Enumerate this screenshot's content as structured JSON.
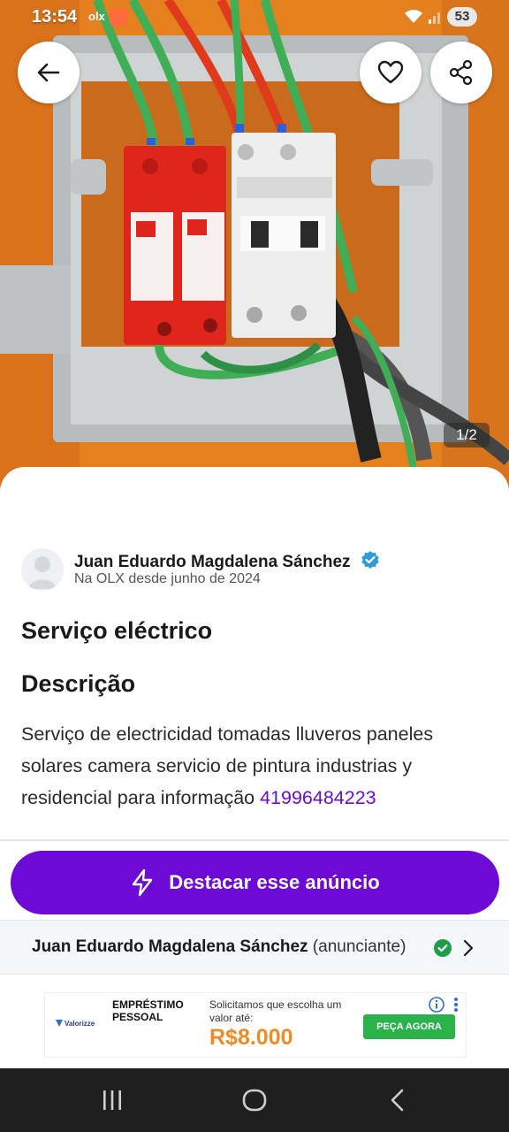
{
  "status_bar": {
    "time": "13:54",
    "app_badge": "olx",
    "battery": "53"
  },
  "gallery": {
    "counter": "1/2",
    "back_icon": "arrow-left-icon",
    "favorite_icon": "heart-outline-icon",
    "share_icon": "share-icon"
  },
  "seller": {
    "name": "Juan Eduardo Magdalena Sánchez",
    "since": "Na OLX desde junho de 2024",
    "verified_color": "#2e9ad8"
  },
  "listing": {
    "title": "Serviço eléctrico",
    "description_heading": "Descrição",
    "description_text": "Serviço de electricidad tomadas lluveros paneles solares camera servicio de pintura industrias y residencial para informação ",
    "phone": "41996484223"
  },
  "highlight_button": {
    "label": "Destacar esse anúncio",
    "color": "#6e0ad6",
    "icon": "lightning-icon"
  },
  "advertiser": {
    "name": "Juan Eduardo Magdalena Sánchez",
    "role": " (anunciante)",
    "status_color": "#1f9e4a"
  },
  "ad": {
    "brand": "Valorizze",
    "headline": "EMPRÉSTIMO PESSOAL",
    "copy": "Solicitamos que escolha um valor até:",
    "amount": "R$8.000",
    "cta": "PEÇA AGORA"
  }
}
